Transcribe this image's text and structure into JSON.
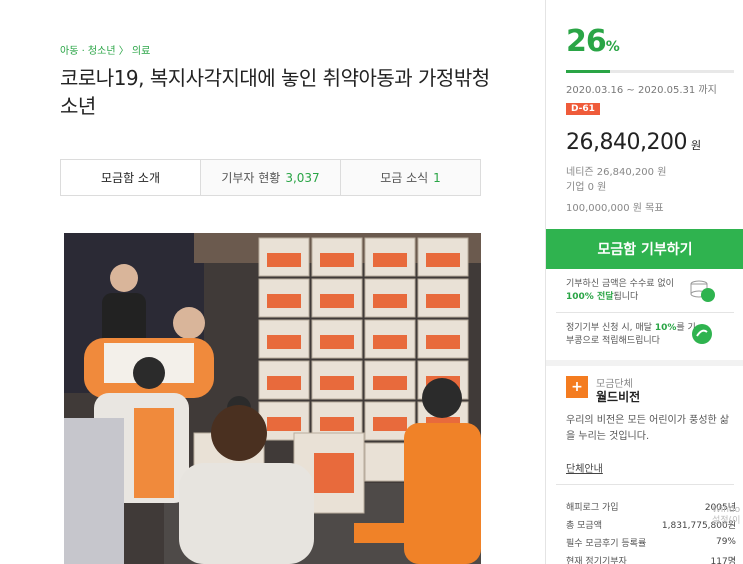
{
  "category": {
    "a": "아동 · 청소년",
    "sep": "〉",
    "b": "의료"
  },
  "title": "코로나19, 복지사각지대에 놓인 취약아동과 가정밖청소년",
  "tabs": [
    {
      "label": "모금함 소개",
      "count": ""
    },
    {
      "label": "기부자 현황",
      "count": "3,037"
    },
    {
      "label": "모금 소식",
      "count": "1"
    }
  ],
  "progress": {
    "value": "26",
    "unit": "%",
    "fraction": 0.26
  },
  "period": "2020.03.16 ~ 2020.05.31 까지",
  "dday": "D-61",
  "amount": {
    "value": "26,840,200",
    "unit": "원"
  },
  "breakdown": {
    "netizen": "네티즌 26,840,200 원",
    "company": "기업 0 원"
  },
  "goal": "100,000,000 원 목표",
  "donate_button": "모금함 기부하기",
  "info1": {
    "pre": "기부하신 금액은 수수료 없이",
    "strong": "100% 전달",
    "post": "됩니다"
  },
  "info2": {
    "pre": "정기기부 신청 시, 매달",
    "strong": "10%",
    "post": "를 기부콩으로 적립해드립니다"
  },
  "org": {
    "tag": "모금단체",
    "name": "월드비전",
    "desc": "우리의 비전은 모든 어린이가 풍성한 삶을 누리는 것입니다.",
    "link": "단체안내"
  },
  "stats": [
    {
      "label": "해피로그 가입",
      "value": "2005년"
    },
    {
      "label": "총 모금액",
      "value": "1,831,775,800원"
    },
    {
      "label": "필수 모금후기 등록률",
      "value": "79%"
    },
    {
      "label": "현재 정기기부자",
      "value": "117명"
    }
  ],
  "watermark": {
    "line1": "Windo",
    "line2": "설정(이"
  },
  "colors": {
    "accent": "#2aa546",
    "button": "#2fb34f",
    "dday": "#ef5b3a",
    "org": "#f47c20"
  }
}
